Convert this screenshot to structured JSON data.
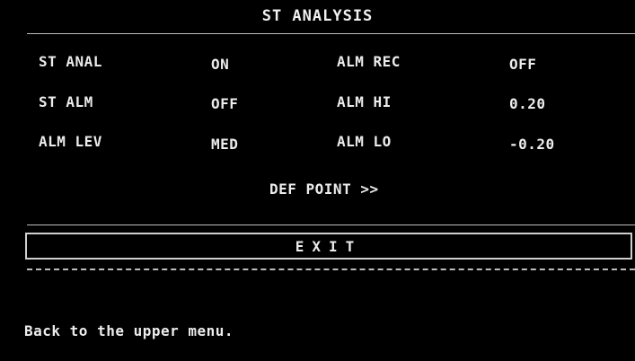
{
  "menu": {
    "title": "ST ANALYSIS",
    "rows": [
      {
        "left_label": "ST ANAL",
        "left_value": "ON",
        "right_label": "ALM REC",
        "right_value": "OFF"
      },
      {
        "left_label": "ST ALM",
        "left_value": "OFF",
        "right_label": "ALM HI",
        "right_value": "0.20"
      },
      {
        "left_label": "ALM LEV",
        "left_value": "MED",
        "right_label": "ALM LO",
        "right_value": "-0.20"
      }
    ],
    "def_point_label": "DEF POINT >>",
    "exit_label": "EXIT",
    "help_text": "Back to the upper menu."
  },
  "colors": {
    "background": "#000000",
    "text": "#ececec",
    "lines": "#bdbdbd"
  }
}
